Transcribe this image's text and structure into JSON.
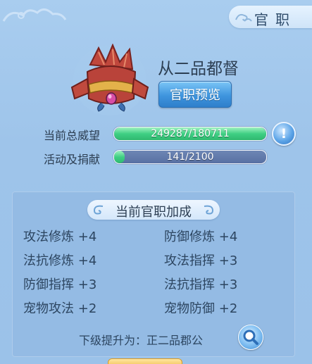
{
  "header": {
    "title": "官职",
    "icon": "cloud-swirl-icon"
  },
  "rank": {
    "name": "从二品都督",
    "emblem_icon": "official-hat-emblem-icon"
  },
  "preview_button": {
    "label": "官职预览"
  },
  "stats": [
    {
      "label": "当前总威望",
      "text": "249287/180711",
      "fill": 1.0,
      "fill_color": "#3fcf83"
    },
    {
      "label": "活动及捐献",
      "text": "141/2100",
      "fill": 0.067,
      "fill_color": "#3fcf83"
    }
  ],
  "info_button": {
    "icon": "info-icon",
    "glyph": "!"
  },
  "bonus_panel": {
    "title": "当前官职加成",
    "items": [
      {
        "name": "攻法修炼",
        "value": "+4"
      },
      {
        "name": "防御修炼",
        "value": "+4"
      },
      {
        "name": "法抗修炼",
        "value": "+4"
      },
      {
        "name": "攻法指挥",
        "value": "+3"
      },
      {
        "name": "防御指挥",
        "value": "+3"
      },
      {
        "name": "法抗指挥",
        "value": "+3"
      },
      {
        "name": "宠物攻法",
        "value": "+2"
      },
      {
        "name": "宠物防御",
        "value": "+2"
      }
    ],
    "next_label": "下级提升为：正二品郡公",
    "search_icon": "magnifier-icon"
  },
  "colors": {
    "accent_blue": "#3f95de",
    "bar_fill": "#3fcf83",
    "panel_bg": "#94bbe4"
  }
}
